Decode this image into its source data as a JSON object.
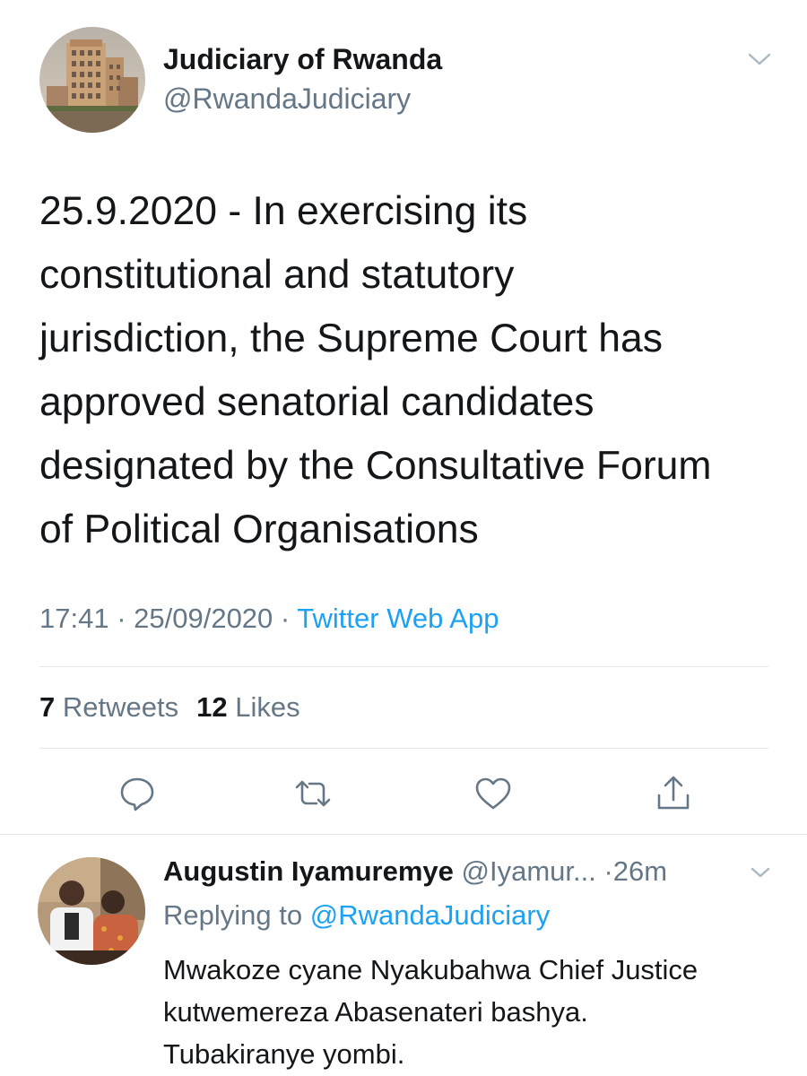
{
  "tweet": {
    "author": {
      "name": "Judiciary of Rwanda",
      "handle": "@RwandaJudiciary"
    },
    "text_lines": [
      "25.9.2020 - In exercising its",
      "constitutional and statutory",
      "jurisdiction, the Supreme Court has",
      "approved senatorial candidates",
      "designated by the Consultative Forum",
      "of Political Organisations"
    ],
    "time": "17:41",
    "date": "25/09/2020",
    "separator": " · ",
    "source": "Twitter Web App",
    "stats": {
      "retweets_count": "7",
      "retweets_label": "Retweets",
      "likes_count": "12",
      "likes_label": "Likes"
    },
    "actions": [
      "reply-icon",
      "retweet-icon",
      "like-icon",
      "share-icon"
    ]
  },
  "reply": {
    "name": "Augustin Iyamuremye",
    "handle": "@Iyamur...",
    "time": "·26m",
    "replying_prefix": "Replying to ",
    "replying_to": "@RwandaJudiciary",
    "text_lines": [
      "Mwakoze cyane Nyakubahwa Chief Justice",
      "kutwemereza Abasenateri bashya.",
      "Tubakiranye yombi."
    ]
  },
  "colors": {
    "text": "#14171a",
    "secondary": "#657786",
    "accent": "#1da1f2",
    "divider": "#e1e8ed"
  }
}
